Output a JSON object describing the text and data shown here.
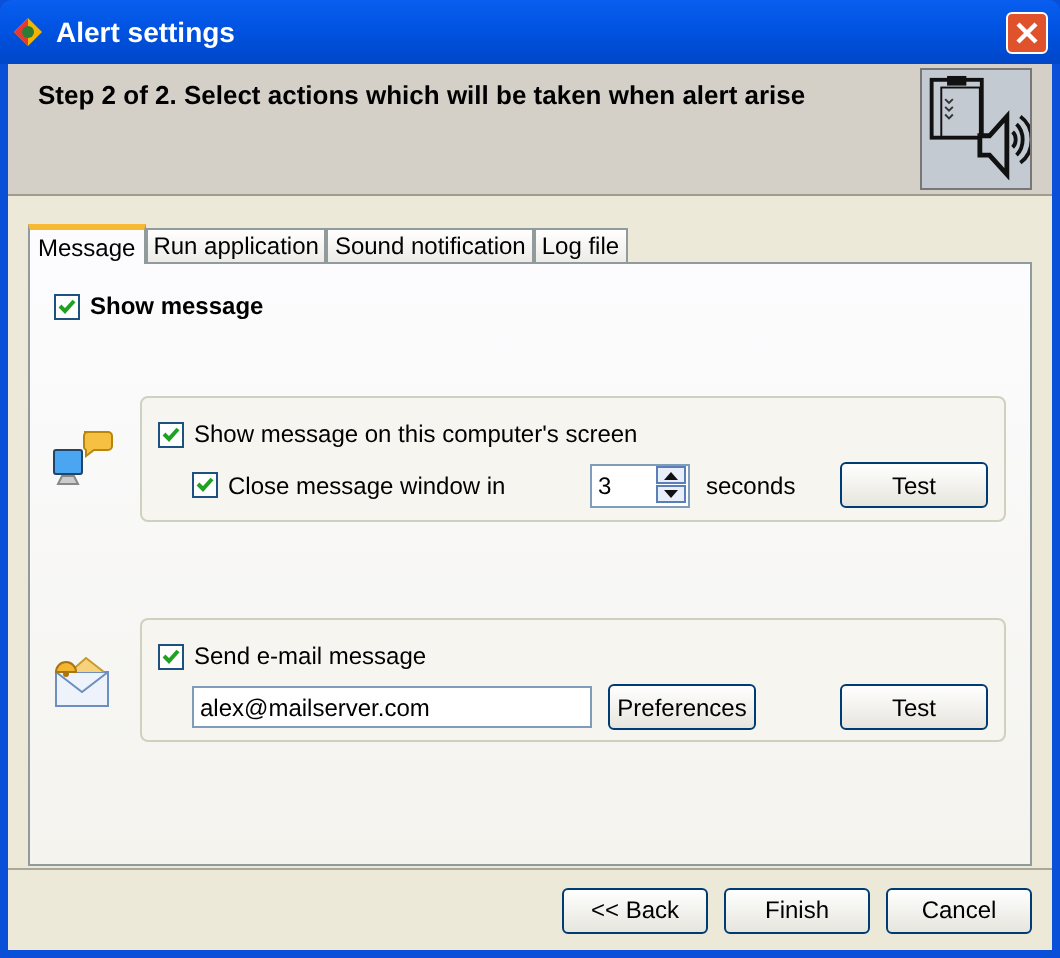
{
  "window": {
    "title": "Alert settings"
  },
  "header": {
    "text": "Step 2 of 2. Select actions which will be taken when alert arise"
  },
  "tabs": [
    {
      "label": "Message",
      "selected": true
    },
    {
      "label": "Run application",
      "selected": false
    },
    {
      "label": "Sound notification",
      "selected": false
    },
    {
      "label": "Log file",
      "selected": false
    }
  ],
  "show_message": {
    "label": "Show message",
    "checked": true
  },
  "screen_group": {
    "show_on_screen": {
      "label": "Show message on this computer's screen",
      "checked": true
    },
    "close_window": {
      "label": "Close message window in",
      "checked": true
    },
    "seconds": {
      "value": "3"
    },
    "seconds_label": "seconds",
    "test_button": "Test"
  },
  "email_group": {
    "send_email": {
      "label": "Send e-mail message",
      "checked": true
    },
    "address": {
      "value": "alex@mailserver.com"
    },
    "preferences_button": "Preferences",
    "test_button": "Test"
  },
  "buttons": [
    "<< Back",
    "Finish",
    "Cancel"
  ]
}
